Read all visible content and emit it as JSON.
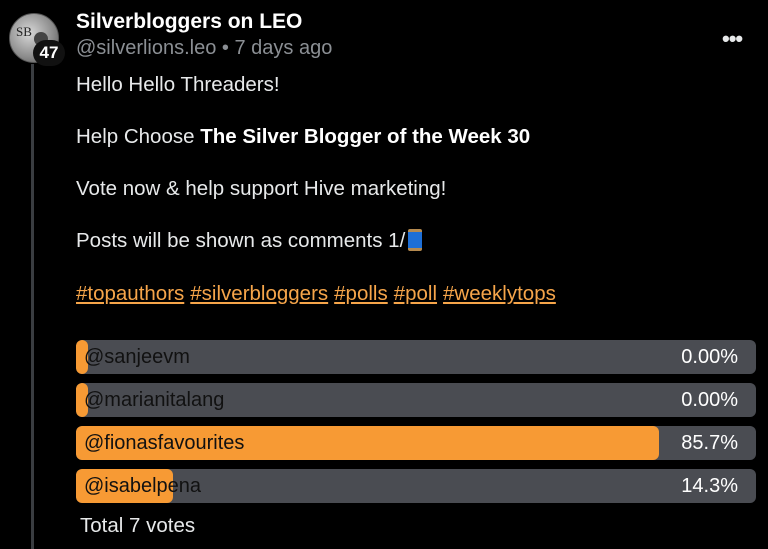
{
  "post": {
    "author_name": "Silverbloggers on LEO",
    "handle_time": "@silverlions.leo • 7 days ago",
    "avatar_text": "SB",
    "level": "47",
    "more_icon": "more-options-icon",
    "greeting": "Hello Hello Threaders!",
    "help_prefix": "Help Choose ",
    "help_bold": "The Silver Blogger of the Week 30",
    "vote_line": "Vote now & help support Hive marketing!",
    "posts_line": "Posts will be shown as comments 1/",
    "spool_icon": "spool-of-thread-icon",
    "tags": [
      "#topauthors",
      "#silverbloggers",
      "#polls",
      "#poll",
      "#weeklytops"
    ]
  },
  "poll": {
    "accent": "#f79a34",
    "options": [
      {
        "label": "@sanjeevm",
        "percent": "0.00%",
        "fraction": 0.0
      },
      {
        "label": "@marianitalang",
        "percent": "0.00%",
        "fraction": 0.0
      },
      {
        "label": "@fionasfavourites",
        "percent": "85.7%",
        "fraction": 0.857
      },
      {
        "label": "@isabelpena",
        "percent": "14.3%",
        "fraction": 0.143
      }
    ],
    "total": "Total 7 votes"
  }
}
